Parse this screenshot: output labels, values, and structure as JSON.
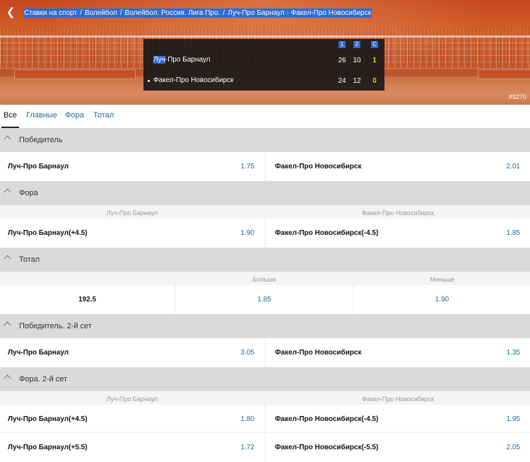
{
  "breadcrumb": {
    "items": [
      "Ставки на спорт",
      "Волейбол",
      "Волейбол. Россия. Лига Про.",
      "Луч-Про Барнаул - Факел-Про Новосибирск"
    ],
    "separator": "/"
  },
  "scoreboard": {
    "headers": [
      "1",
      "2",
      "С"
    ],
    "home": {
      "highlight": "Луч",
      "rest": "-Про Барнаул",
      "set1": "26",
      "set2": "10",
      "sets": "1"
    },
    "away": {
      "name": "Факел-Про Новосибирск",
      "set1": "24",
      "set2": "12",
      "sets": "0"
    }
  },
  "match_id": "#9270",
  "tabs": [
    "Все",
    "Главные",
    "Фора",
    "Тотал"
  ],
  "markets": {
    "winner": {
      "title": "Победитель",
      "home_name": "Луч-Про Барнаул",
      "home_odds": "1.75",
      "away_name": "Факел-Про Новосибирск",
      "away_odds": "2.01"
    },
    "handicap": {
      "title": "Фора",
      "sub_home": "Луч-Про Барнаул",
      "sub_away": "Факел-Про Новосибирск",
      "home_name": "Луч-Про Барнаул(+4.5)",
      "home_odds": "1.90",
      "away_name": "Факел-Про Новосибирск(-4.5)",
      "away_odds": "1.85"
    },
    "total": {
      "title": "Тотал",
      "sub_over": "Больше",
      "sub_under": "Меньше",
      "line": "192.5",
      "over_odds": "1.85",
      "under_odds": "1.90"
    },
    "winner_set2": {
      "title": "Победитель. 2-й сет",
      "home_name": "Луч-Про Барнаул",
      "home_odds": "3.05",
      "away_name": "Факел-Про Новосибирск",
      "away_odds": "1.35"
    },
    "handicap_set2": {
      "title": "Фора. 2-й сет",
      "sub_home": "Луч-Про Барнаул",
      "sub_away": "Факел-Про Новосибирск",
      "rows": [
        {
          "home_name": "Луч-Про Барнаул(+4.5)",
          "home_odds": "1.80",
          "away_name": "Факел-Про Новосибирск(-4.5)",
          "away_odds": "1.95"
        },
        {
          "home_name": "Луч-Про Барнаул(+5.5)",
          "home_odds": "1.72",
          "away_name": "Факел-Про Новосибирск(-5.5)",
          "away_odds": "2.05"
        }
      ]
    }
  },
  "colors": {
    "accent": "#1b6e98",
    "highlight": "#2e6bd8",
    "current_set": "#f5d200",
    "hero": "#c8572a"
  }
}
